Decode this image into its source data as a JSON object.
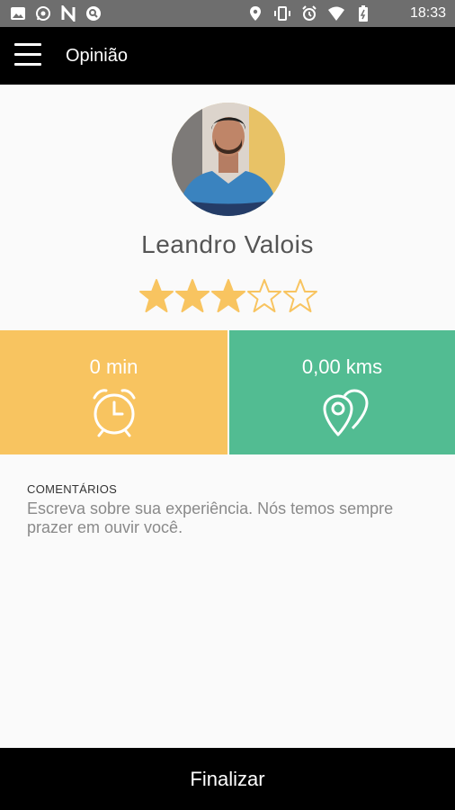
{
  "status_bar": {
    "time": "18:33",
    "left_icons": [
      "gallery-icon",
      "whatsapp-icon",
      "n-icon",
      "search-circle-icon"
    ],
    "right_icons": [
      "location-icon",
      "vibrate-icon",
      "alarm-icon",
      "wifi-icon",
      "battery-icon"
    ]
  },
  "app_bar": {
    "title": "Opinião",
    "menu_icon": "hamburger-icon"
  },
  "driver": {
    "name": "Leandro Valois",
    "rating": 3,
    "max_rating": 5
  },
  "stats": {
    "time": {
      "value": "0 min",
      "icon": "alarm-clock-icon",
      "color": "#f8c460"
    },
    "distance": {
      "value": "0,00 kms",
      "icon": "map-pins-icon",
      "color": "#52bc92"
    }
  },
  "comments": {
    "label": "COMENTÁRIOS",
    "placeholder": "Escreva sobre sua experiência. Nós temos sempre prazer em ouvir você.",
    "value": ""
  },
  "footer": {
    "finish_label": "Finalizar"
  },
  "colors": {
    "star": "#f8c460",
    "app_bar": "#000000",
    "status_bar": "#6e6e6e"
  }
}
